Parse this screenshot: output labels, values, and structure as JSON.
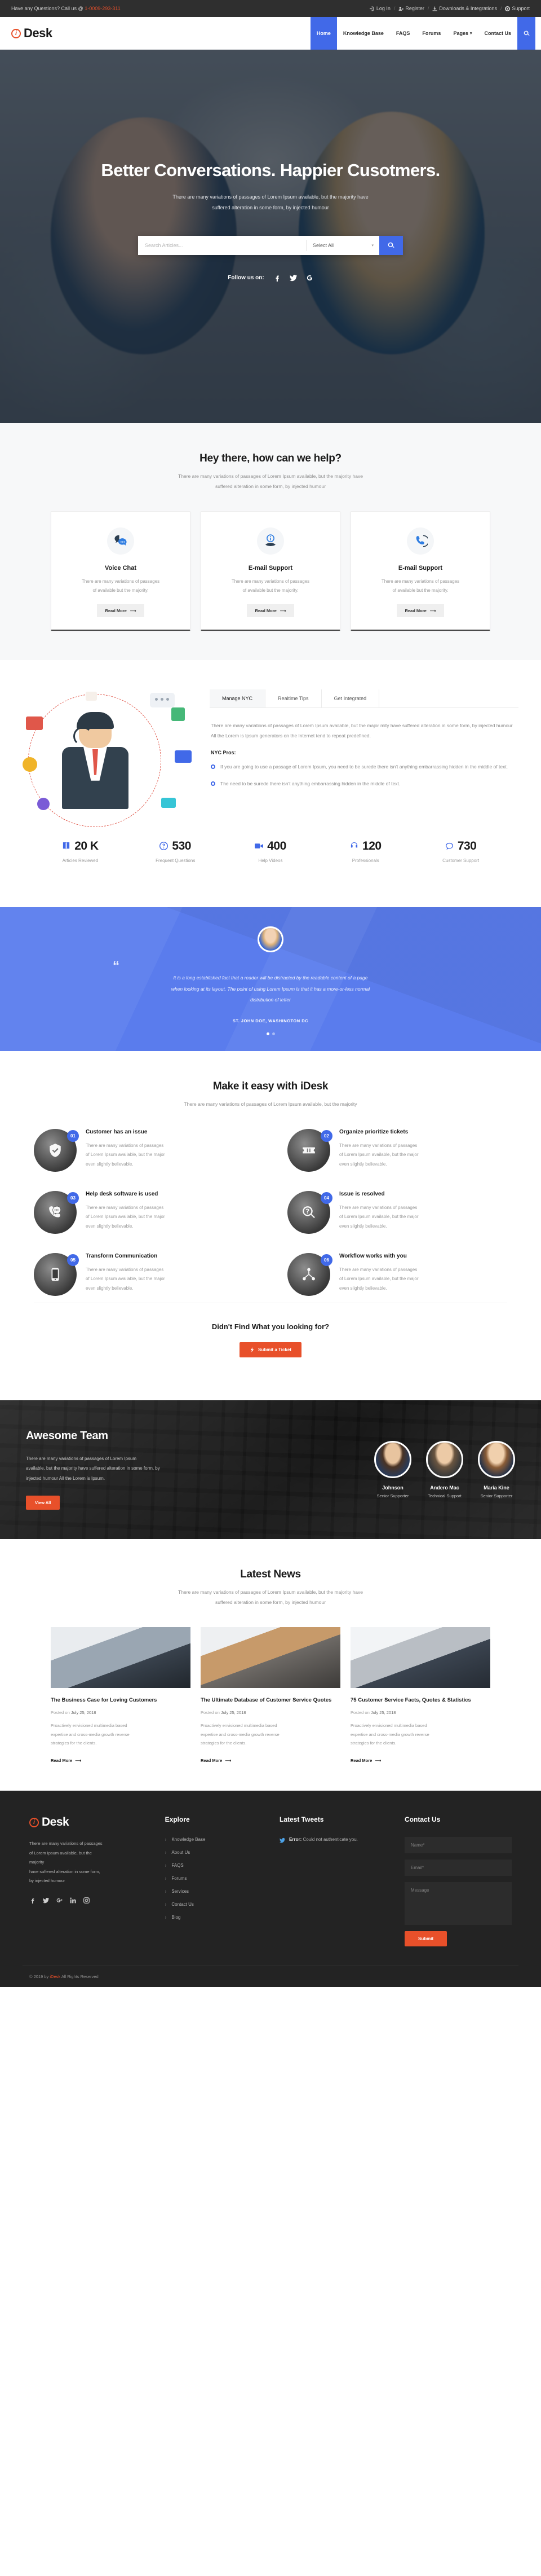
{
  "topbar": {
    "question": "Have any Questions? Call us @ ",
    "phone": "1-0009-293-311",
    "links": [
      {
        "label": "Log In",
        "icon": "login-icon"
      },
      {
        "label": "Register",
        "icon": "user-plus-icon"
      },
      {
        "label": "Downloads & Integrations",
        "icon": "download-icon"
      },
      {
        "label": "Support",
        "icon": "life-ring-icon"
      }
    ],
    "separator": "/"
  },
  "brand": {
    "mark": "i",
    "name": "Desk"
  },
  "nav": {
    "items": [
      {
        "label": "Home",
        "active": true
      },
      {
        "label": "Knowledge Base",
        "active": false
      },
      {
        "label": "FAQS",
        "active": false
      },
      {
        "label": "Forums",
        "active": false
      },
      {
        "label": "Pages",
        "active": false,
        "dropdown": true
      },
      {
        "label": "Contact Us",
        "active": false
      }
    ],
    "search_icon": "search-icon"
  },
  "hero": {
    "title": "Better Conversations. Happier Cusotmers.",
    "subtitle_line1": "There are many variations of passages of Lorem Ipsum available, but the majority have",
    "subtitle_line2": "suffered alteration in some form, by injected humour",
    "search_placeholder": "Search Articles...",
    "search_value": "",
    "select_value": "Select All",
    "search_button_icon": "search-icon",
    "follow_label": "Follow us on:",
    "social": [
      "facebook-icon",
      "twitter-icon",
      "google-plus-icon"
    ]
  },
  "help": {
    "title": "Hey there, how can we help?",
    "sub_line1": "There are many variations of passages of Lorem Ipsum available, but the majority have",
    "sub_line2": "suffered alteration in some form, by injected humour",
    "cards": [
      {
        "icon": "chat-bubbles-icon",
        "title": "Voice Chat",
        "text_line1": "There are many variations of passages",
        "text_line2": "of available but the majority.",
        "button": "Read More"
      },
      {
        "icon": "info-hand-icon",
        "title": "E-mail Support",
        "text_line1": "There are many variations of passages",
        "text_line2": "of available but the majority.",
        "button": "Read More"
      },
      {
        "icon": "phone-icon",
        "title": "E-mail Support",
        "text_line1": "There are many variations of passages",
        "text_line2": "of available but the majority.",
        "button": "Read More"
      }
    ]
  },
  "tabsection": {
    "tabs": [
      {
        "label": "Manage NYC",
        "active": true
      },
      {
        "label": "Realtime Tips",
        "active": false
      },
      {
        "label": "Get Integrated",
        "active": false
      }
    ],
    "paragraph": "There are many variations of passages of Lorem Ipsum available, but the major mity have suffered alteration in some form, by injected humour All the Lorem is Ipsum generators on the Internet tend to repeat predefined.",
    "pros_heading": "NYC Pros:",
    "pros": [
      "If you are going to use a passage of Lorem Ipsum, you need to be surede there isn't anything embarrassing hidden in the middle of text.",
      "The need to be surede there isn't anything embarrassing hidden in the middle of text."
    ]
  },
  "stats": [
    {
      "icon": "book-icon",
      "value": "20 K",
      "label": "Articles Reviewed"
    },
    {
      "icon": "question-circle-icon",
      "value": "530",
      "label": "Frequent Questions"
    },
    {
      "icon": "video-icon",
      "value": "400",
      "label": "Help Videos"
    },
    {
      "icon": "headset-icon",
      "value": "120",
      "label": "Professionals"
    },
    {
      "icon": "comment-icon",
      "value": "730",
      "label": "Customer Support"
    }
  ],
  "testimonial": {
    "quote_mark": "“",
    "quote_line1": "It is a long established fact that a reader will be distracted by the readable content of a page",
    "quote_line2": "when looking at its layout. The point of using Lorem Ipsum is that it has a more-or-less normal",
    "quote_line3": "distribution of letter",
    "author": "ST. JOHN DOE, WASHINGTON DC",
    "dot_count": 2,
    "active_dot": 0
  },
  "features": {
    "title": "Make it easy with iDesk",
    "subtitle": "There are many variations of passages of Lorem Ipsum available, but the majority",
    "items": [
      {
        "num": "01",
        "icon": "shield-check-icon",
        "title": "Customer has an issue",
        "l1": "There are many variations of passages",
        "l2": "of Lorem Ipsum available, but the major",
        "l3": "even slightly believable."
      },
      {
        "num": "02",
        "icon": "ticket-icon",
        "title": "Organize prioritize tickets",
        "l1": "There are many variations of passages",
        "l2": "of Lorem Ipsum available, but the major",
        "l3": "even slightly believable."
      },
      {
        "num": "03",
        "icon": "phone-chat-icon",
        "title": "Help desk software is used",
        "l1": "There are many variations of passages",
        "l2": "of Lorem Ipsum available, but the major",
        "l3": "even slightly believable."
      },
      {
        "num": "04",
        "icon": "search-question-icon",
        "title": "Issue is resolved",
        "l1": "There are many variations of passages",
        "l2": "of Lorem Ipsum available, but the major",
        "l3": "even slightly believable."
      },
      {
        "num": "05",
        "icon": "mobile-icon",
        "title": "Transform Communication",
        "l1": "There are many variations of passages",
        "l2": "of Lorem Ipsum available, but the major",
        "l3": "even slightly believable."
      },
      {
        "num": "06",
        "icon": "workflow-icon",
        "title": "Workflow works with you",
        "l1": "There are many variations of passages",
        "l2": "of Lorem Ipsum available, but the major",
        "l3": "even slightly believable."
      }
    ],
    "cta_title": "Didn't Find What you looking for?",
    "cta_button": "Submit a Ticket",
    "cta_icon": "bolt-icon"
  },
  "team": {
    "title": "Awesome Team",
    "text_l1": "There are many variations of passages of Lorem Ipsum",
    "text_l2": "available, but the majority have suffered alteration in some form, by",
    "text_l3": "injected humour All the Lorem is Ipsum.",
    "button": "View All",
    "members": [
      {
        "name": "Johnson",
        "role": "Senior Supporter"
      },
      {
        "name": "Andero Mac",
        "role": "Technical Support"
      },
      {
        "name": "Maria Kine",
        "role": "Senior Supporter"
      }
    ]
  },
  "news": {
    "title": "Latest News",
    "sub_line1": "There are many variations of passages of Lorem Ipsum available, but the majority have",
    "sub_line2": "suffered alteration in some form, by injected humour",
    "posts": [
      {
        "title": "The Business Case for Loving Customers",
        "meta_prefix": "Posted on ",
        "meta_date": "July 25, 2018",
        "excerpt_l1": "Proactively envisioned multimedia based",
        "excerpt_l2": "expertise and cross-media growth reverse",
        "excerpt_l3": "strategies for the clients.",
        "more": "Read More"
      },
      {
        "title": "The Ultimate Database of Customer Service Quotes",
        "meta_prefix": "Posted on ",
        "meta_date": "July 25, 2018",
        "excerpt_l1": "Proactively envisioned multimedia based",
        "excerpt_l2": "expertise and cross-media growth reverse",
        "excerpt_l3": "strategies for the clients.",
        "more": "Read More"
      },
      {
        "title": "75 Customer Service Facts, Quotes & Statistics",
        "meta_prefix": "Posted on ",
        "meta_date": "July 25, 2018",
        "excerpt_l1": "Proactively envisioned multimedia based",
        "excerpt_l2": "expertise and cross-media growth reverse",
        "excerpt_l3": "strategies for the clients.",
        "more": "Read More"
      }
    ]
  },
  "footer": {
    "about_l1": "There are many variations of passages",
    "about_l2": "of Lorem Ipsum available, but the",
    "about_l3": "majority",
    "about_l4": "have suffered alteration in some form,",
    "about_l5": "by injected humour",
    "social": [
      "facebook-icon",
      "twitter-icon",
      "google-plus-icon",
      "linkedin-icon",
      "instagram-icon"
    ],
    "explore_title": "Explore",
    "explore_links": [
      "Knowledge Base",
      "About Us",
      "FAQS",
      "Forums",
      "Services",
      "Contact Us",
      "Blog"
    ],
    "tweets_title": "Latest Tweets",
    "tweet_error_label": "Error:",
    "tweet_error_text": " Could not authenticate you.",
    "contact_title": "Contact Us",
    "name_placeholder": "Name*",
    "email_placeholder": "Email*",
    "message_placeholder": "Message",
    "submit": "Submit",
    "copyright_pre": "© 2019 by ",
    "copyright_brand": "iDesk",
    "copyright_post": " All Rights Reserved"
  },
  "colors": {
    "accent_blue": "#4169e8",
    "accent_orange": "#e8502a",
    "dark": "#232323",
    "testimonial_bg": "#5a7ced"
  }
}
